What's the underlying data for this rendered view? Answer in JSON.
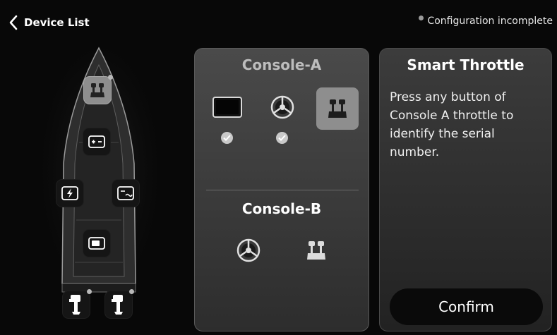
{
  "header": {
    "back_label": "Device List",
    "status_text": "Configuration incomplete"
  },
  "boat": {
    "devices": [
      {
        "name": "throttle-icon",
        "active": true,
        "indicator": true
      },
      {
        "name": "battery-icon",
        "active": false,
        "indicator": false
      },
      {
        "name": "power-charger-icon",
        "active": false,
        "indicator": false
      },
      {
        "name": "inverter-icon",
        "active": false,
        "indicator": false
      },
      {
        "name": "display-icon",
        "active": false,
        "indicator": false
      },
      {
        "name": "outboard-motor-icon",
        "active": false,
        "indicator": true
      },
      {
        "name": "outboard-motor-icon",
        "active": false,
        "indicator": true
      }
    ]
  },
  "consoles": {
    "a": {
      "title": "Console-A",
      "devices": [
        {
          "name": "display-icon",
          "configured": true
        },
        {
          "name": "steering-wheel-icon",
          "configured": true
        },
        {
          "name": "throttle-icon",
          "configured": false,
          "selected": true
        }
      ]
    },
    "b": {
      "title": "Console-B",
      "devices": [
        {
          "name": "steering-wheel-icon",
          "configured": false
        },
        {
          "name": "throttle-icon",
          "configured": false
        }
      ]
    }
  },
  "info": {
    "title": "Smart Throttle",
    "text": "Press any button of Console A throttle to identify the serial number.",
    "confirm_label": "Confirm"
  },
  "colors": {
    "background": "#080808",
    "selected": "#8e8e8e",
    "check": "#c9c9c9"
  }
}
